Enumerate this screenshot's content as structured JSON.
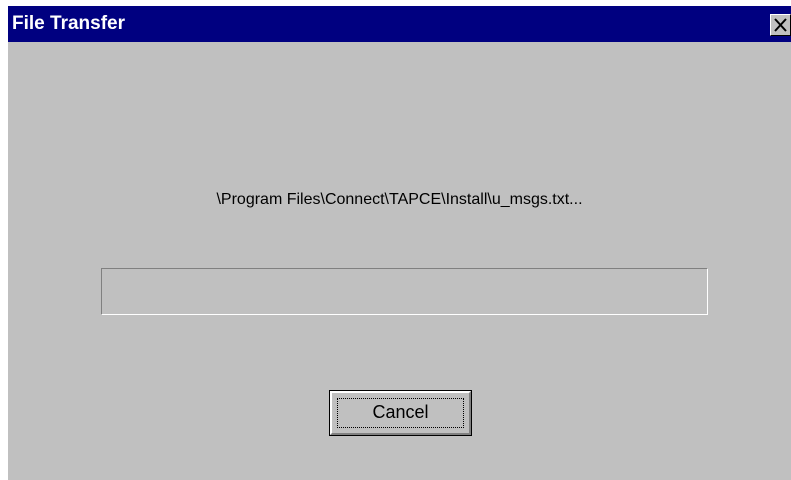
{
  "window": {
    "title": "File Transfer",
    "close_icon": "close-icon"
  },
  "transfer": {
    "file_path": "\\Program Files\\Connect\\TAPCE\\Install\\u_msgs.txt...",
    "progress_fraction": 0
  },
  "buttons": {
    "cancel_label": "Cancel"
  },
  "colors": {
    "titlebar": "#000080",
    "title_text": "#ffffff",
    "window_face": "#c0c0c0",
    "progress_fill": "#000080"
  }
}
